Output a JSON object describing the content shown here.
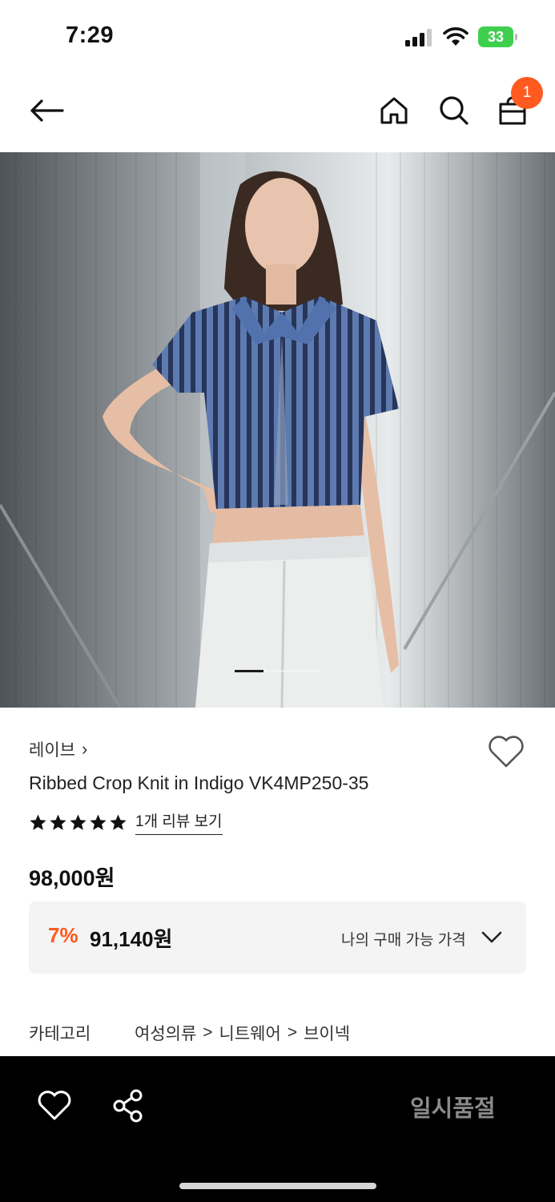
{
  "status_bar": {
    "time": "7:29",
    "battery_percent": "33",
    "battery_color": "#3fcf4f"
  },
  "nav": {
    "back_icon": "arrow-left-icon",
    "home_icon": "home-icon",
    "search_icon": "search-icon",
    "bag_icon": "shopping-bag-icon",
    "cart_count": "1",
    "badge_color": "#ff5a1f"
  },
  "hero": {
    "image_index": 1,
    "image_count": 3,
    "image_description": "Model in blue ribbed crop knit and white jeans"
  },
  "product": {
    "brand": "레이브",
    "brand_chevron": "›",
    "name": "Ribbed Crop Knit in Indigo VK4MP250-35",
    "rating": 5,
    "review_link": "1개 리뷰 보기",
    "price": "98,000원",
    "discount_rate": "7%",
    "discounted_price": "91,140원",
    "my_price_label": "나의 구매 가능 가격",
    "accent_color": "#ff5a1f"
  },
  "category": {
    "label": "카테고리",
    "path": [
      "여성의류",
      "니트웨어",
      "브이넥"
    ],
    "separator": ">"
  },
  "bottom_bar": {
    "wishlist_icon": "heart-icon",
    "share_icon": "share-icon",
    "soldout_label": "일시품절"
  }
}
